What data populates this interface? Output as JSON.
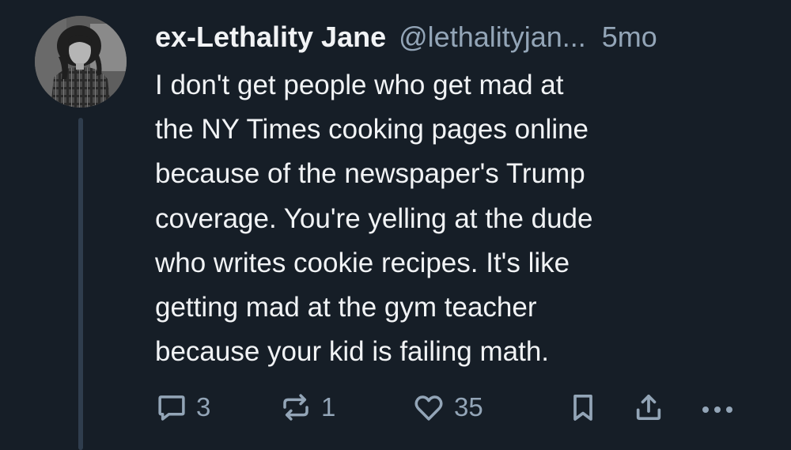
{
  "post": {
    "author_name": "ex-Lethality Jane",
    "author_handle": "@lethalityjan...",
    "time_ago": "5mo",
    "text": "I don't get people who get mad at\nthe NY Times cooking pages online\nbecause of the newspaper's Trump\ncoverage. You're yelling at the dude\nwho writes cookie recipes. It's like\ngetting mad at the gym teacher\nbecause your kid is failing math."
  },
  "actions": {
    "reply_count": "3",
    "repost_count": "1",
    "like_count": "35",
    "icons": [
      "reply-icon",
      "repost-icon",
      "like-icon",
      "bookmark-icon",
      "share-icon",
      "more-icon"
    ]
  },
  "colors": {
    "background": "#161e27",
    "primary_text": "#f1f3f5",
    "secondary_text": "#93a5b7",
    "thread_line": "#2f3d4d"
  }
}
